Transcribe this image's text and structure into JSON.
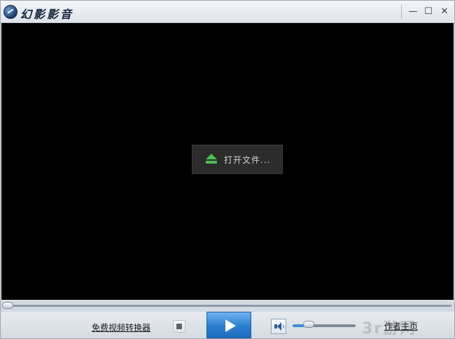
{
  "window": {
    "title": "幻影影音",
    "controls": {
      "minimize": "—",
      "maximize": "☐",
      "close": "✕"
    }
  },
  "video": {
    "open_file_label": "打开文件..."
  },
  "seek": {
    "progress": 0
  },
  "controls": {
    "converter_link": "免费视频转换器",
    "homepage_link": "作者主页",
    "volume_level": 0.25
  },
  "watermark": {
    "text": "3r游网"
  },
  "icons": {
    "app": "app-logo-icon",
    "open": "eject-icon",
    "stop": "stop-icon",
    "play": "play-icon",
    "volume": "speaker-icon"
  },
  "colors": {
    "play_button": "#2a7ed0",
    "eject_icon": "#4ec04e",
    "video_bg": "#000000"
  }
}
